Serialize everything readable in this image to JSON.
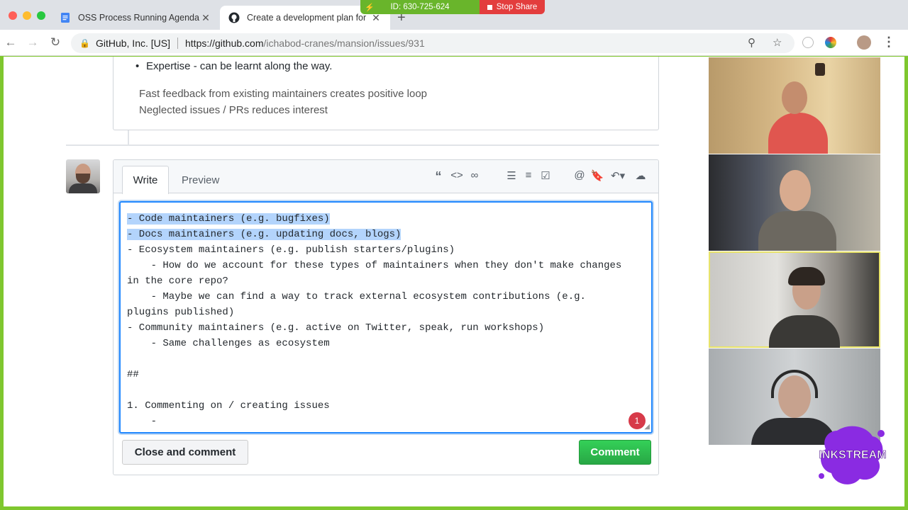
{
  "browser": {
    "tabs": [
      {
        "title": "OSS Process Running Agenda",
        "active": false,
        "icon": "google-docs-icon"
      },
      {
        "title": "Create a development plan for",
        "active": true,
        "icon": "github-icon"
      }
    ],
    "new_tab_glyph": "+",
    "address_bar": {
      "org": "GitHub, Inc. [US]",
      "url_host": "https://github.com",
      "url_path": "/ichabod-cranes/mansion/issues/931"
    }
  },
  "screen_share": {
    "id_label": "ID: 630-725-624",
    "stop_label": "Stop Share"
  },
  "previous_comment": {
    "bullet": "Expertise - can be learnt along the way.",
    "lines": [
      "Fast feedback from existing maintainers creates positive loop",
      "Neglected issues / PRs reduces interest"
    ]
  },
  "composer": {
    "tabs": {
      "write": "Write",
      "preview": "Preview"
    },
    "editor_lines": [
      "- Code maintainers (e.g. bugfixes)",
      "- Docs maintainers (e.g. updating docs, blogs)",
      "- Ecosystem maintainers (e.g. publish starters/plugins)",
      "    - How do we account for these types of maintainers when they don't make changes",
      "in the core repo?",
      "    - Maybe we can find a way to track external ecosystem contributions (e.g.",
      "plugins published)",
      "- Community maintainers (e.g. active on Twitter, speak, run workshops)",
      "    - Same challenges as ecosystem",
      "",
      "##",
      "",
      "1. Commenting on / creating issues",
      "    -"
    ],
    "notification_count": "1",
    "close_button": "Close and comment",
    "comment_button": "Comment"
  },
  "watermark": "INKSTREAM",
  "colors": {
    "frame": "#7fc72f",
    "comment_green": "#2cbe4e",
    "share_green": "#69b52b",
    "stop_red": "#e33d3d",
    "focus_blue": "#2188ff",
    "selection": "#b3d4fc",
    "active_speaker": "#e8e36a"
  }
}
